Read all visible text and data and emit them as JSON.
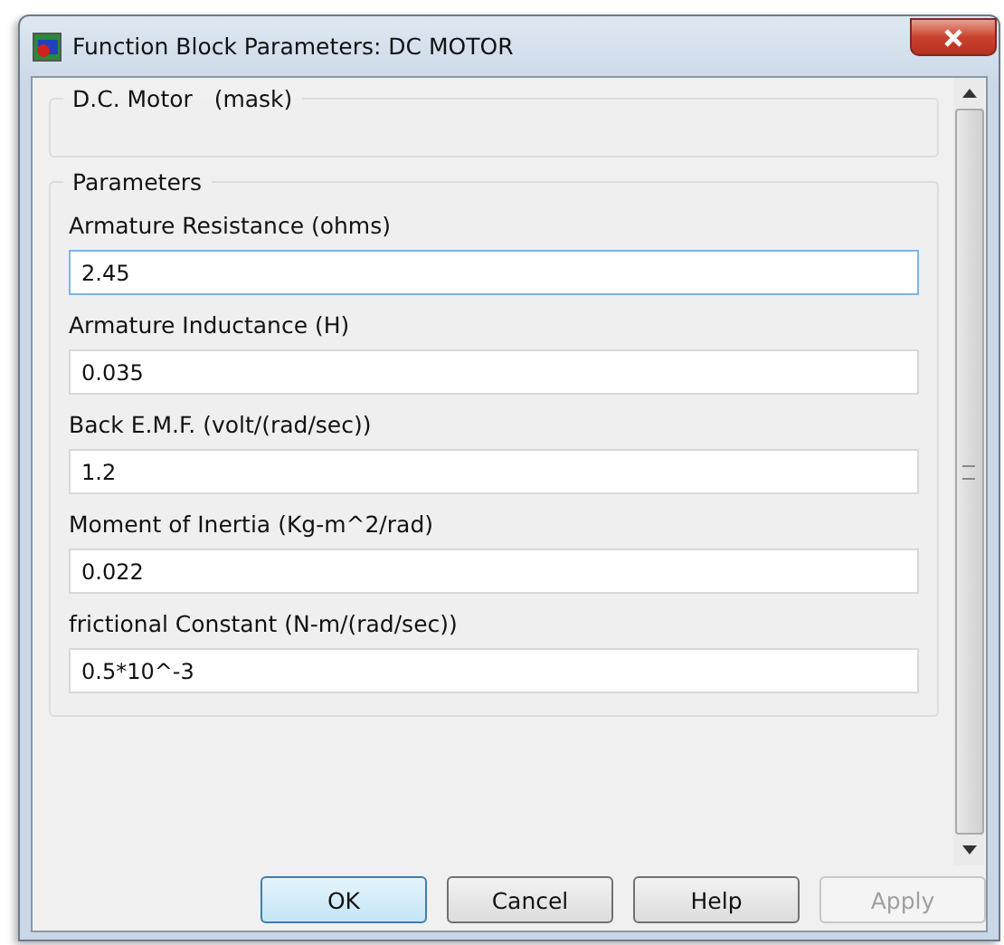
{
  "window": {
    "title": "Function Block Parameters: DC MOTOR"
  },
  "mask_group": {
    "title": "D.C. Motor   (mask)"
  },
  "parameters": {
    "title": "Parameters",
    "fields": [
      {
        "label": "Armature Resistance (ohms)",
        "value": "2.45",
        "focused": true
      },
      {
        "label": "Armature Inductance (H)",
        "value": "0.035",
        "focused": false
      },
      {
        "label": "Back E.M.F. (volt/(rad/sec))",
        "value": "1.2",
        "focused": false
      },
      {
        "label": "Moment of Inertia (Kg-m^2/rad)",
        "value": "0.022",
        "focused": false
      },
      {
        "label": "frictional Constant (N-m/(rad/sec))",
        "value": "0.5*10^-3",
        "focused": false
      }
    ]
  },
  "buttons": [
    {
      "label": "OK",
      "default": true,
      "disabled": false
    },
    {
      "label": "Cancel",
      "default": false,
      "disabled": false
    },
    {
      "label": "Help",
      "default": false,
      "disabled": false
    },
    {
      "label": "Apply",
      "default": false,
      "disabled": true
    }
  ]
}
